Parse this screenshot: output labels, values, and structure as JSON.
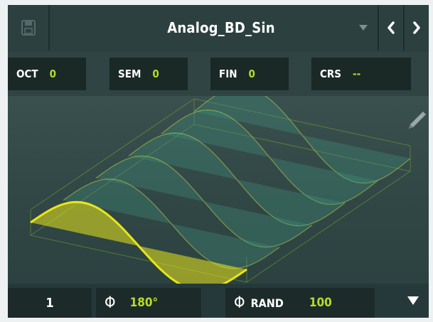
{
  "preset": {
    "name": "Analog_BD_Sin",
    "save_icon": "floppy-disk-icon",
    "dropdown_icon": "triangle-down-icon",
    "prev_icon": "chevron-left-icon",
    "next_icon": "chevron-right-icon"
  },
  "params": [
    {
      "label": "OCT",
      "value": "0"
    },
    {
      "label": "SEM",
      "value": "0"
    },
    {
      "label": "FIN",
      "value": "0"
    },
    {
      "label": "CRS",
      "value": "--"
    }
  ],
  "wavetable": {
    "edit_icon": "pencil-icon",
    "accent_color": "#e9e51a",
    "wave_color": "#3e8f7a"
  },
  "bottom": {
    "frame_number": "1",
    "phase_symbol": "Φ",
    "phase_value": "180°",
    "rand_symbol": "Φ",
    "rand_label": "RAND",
    "rand_value": "100",
    "menu_icon": "triangle-down-icon"
  },
  "colors": {
    "value_green": "#b6dd2a",
    "panel_bg": "#2a3f3e"
  }
}
